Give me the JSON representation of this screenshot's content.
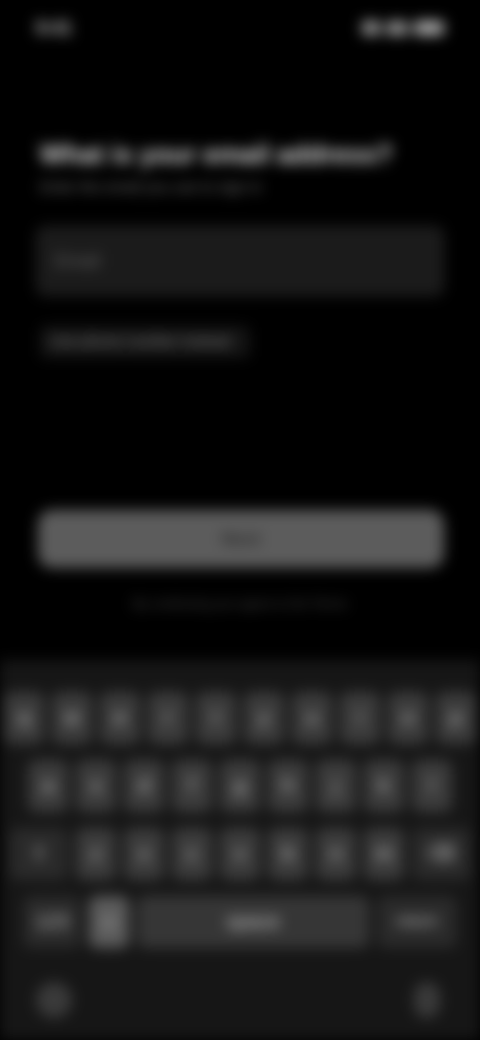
{
  "status_bar": {
    "time": "9:41",
    "icons": [
      "signal-icon",
      "wifi-icon",
      "battery-icon"
    ]
  },
  "form": {
    "title": "What is your email address?",
    "subtitle": "Enter the email you use to sign in",
    "email_placeholder": "Email",
    "email_value": "",
    "alt_link": "Use phone number instead",
    "continue_label": "Next",
    "footer_note": "By continuing you agree to the Terms"
  },
  "keyboard": {
    "row1": [
      "q",
      "w",
      "e",
      "r",
      "t",
      "y",
      "u",
      "i",
      "o",
      "p"
    ],
    "row2": [
      "a",
      "s",
      "d",
      "f",
      "g",
      "h",
      "j",
      "k",
      "l"
    ],
    "row3": [
      "z",
      "x",
      "c",
      "v",
      "b",
      "n",
      "m"
    ],
    "shift_label": "⇧",
    "backspace_label": "⌫",
    "numbers_label": "123",
    "emoji_label": "☺",
    "space_label": "space",
    "return_label": "return"
  },
  "colors": {
    "background": "#000000",
    "button": "#5c5c5c",
    "keyboard": "#161616"
  }
}
